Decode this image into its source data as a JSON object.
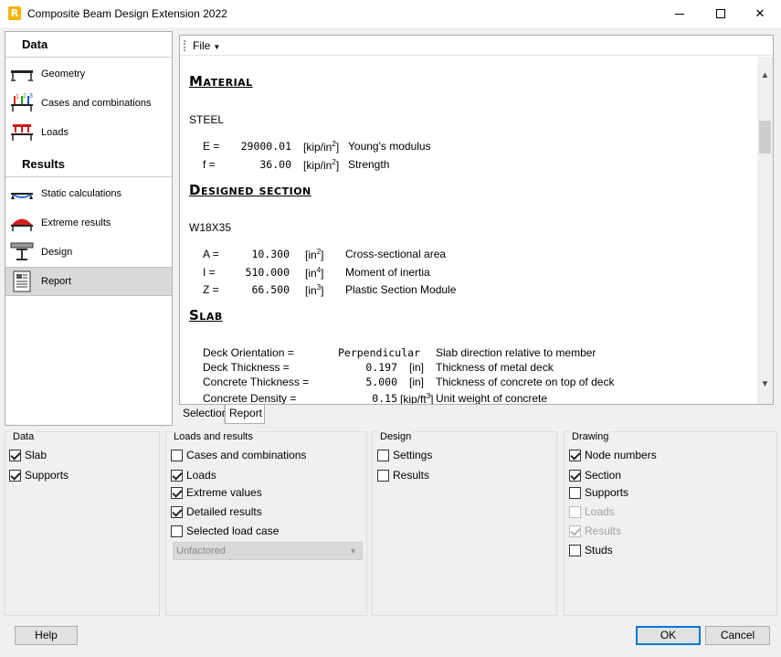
{
  "window": {
    "title": "Composite Beam Design Extension 2022",
    "app_icon_letter": "R",
    "minimize": "minimize-icon",
    "maximize": "maximize-icon",
    "close": "✕"
  },
  "nav": {
    "data_header": "Data",
    "results_header": "Results",
    "items": [
      {
        "label": "Geometry",
        "icon": "geometry-icon"
      },
      {
        "label": "Cases and combinations",
        "icon": "cases-icon"
      },
      {
        "label": "Loads",
        "icon": "loads-icon"
      },
      {
        "label": "Static calculations",
        "icon": "static-calc-icon"
      },
      {
        "label": "Extreme results",
        "icon": "extreme-results-icon"
      },
      {
        "label": "Design",
        "icon": "design-icon"
      },
      {
        "label": "Report",
        "icon": "report-icon"
      }
    ],
    "active": "Report"
  },
  "report": {
    "toolbar": {
      "file_label": "File"
    },
    "material": {
      "heading": "Material",
      "type": "STEEL",
      "rows": [
        {
          "sym": "E =",
          "val": "29000.01",
          "unit_base": "[kip/in",
          "unit_sup": "2",
          "unit_end": "]",
          "desc": "Young's modulus"
        },
        {
          "sym": "f =",
          "val": "36.00",
          "unit_base": "[kip/in",
          "unit_sup": "2",
          "unit_end": "]",
          "desc": "Strength"
        }
      ]
    },
    "section": {
      "heading": "Designed section",
      "name": "W18X35",
      "rows": [
        {
          "sym": "A =",
          "val": "10.300",
          "unit_base": "[in",
          "unit_sup": "2",
          "unit_end": "]",
          "desc": "Cross-sectional area"
        },
        {
          "sym": "I =",
          "val": "510.000",
          "unit_base": "[in",
          "unit_sup": "4",
          "unit_end": "]",
          "desc": "Moment of inertia"
        },
        {
          "sym": "Z =",
          "val": "66.500",
          "unit_base": "[in",
          "unit_sup": "3",
          "unit_end": "]",
          "desc": "Plastic Section Module"
        }
      ]
    },
    "slab": {
      "heading": "Slab",
      "rows": [
        {
          "sym": "Deck Orientation =",
          "val": "Perpendicular",
          "unit": "",
          "desc": "Slab direction relative to member"
        },
        {
          "sym": "Deck Thickness =",
          "val": "0.197",
          "unit": "[in]",
          "desc": "Thickness of metal deck"
        },
        {
          "sym": "Concrete Thickness =",
          "val": "5.000",
          "unit": "[in]",
          "desc": "Thickness of concrete on top of deck"
        },
        {
          "sym": "Concrete Density =",
          "val": "0.15",
          "unit_base": "[kip/ft",
          "unit_sup": "3",
          "unit_end": "]",
          "desc": "Unit weight of concrete"
        }
      ]
    }
  },
  "tabs": {
    "selection": "Selection",
    "report": "Report"
  },
  "groups": {
    "data": {
      "title": "Data",
      "items": [
        {
          "label": "Slab",
          "checked": true
        },
        {
          "label": "Supports",
          "checked": true
        }
      ]
    },
    "loads": {
      "title": "Loads and results",
      "items": [
        {
          "label": "Cases and combinations",
          "checked": false
        },
        {
          "label": "Loads",
          "checked": true
        },
        {
          "label": "Extreme values",
          "checked": true
        },
        {
          "label": "Detailed results",
          "checked": true
        },
        {
          "label": "Selected load case",
          "checked": false
        }
      ],
      "combo_value": "Unfactored"
    },
    "design": {
      "title": "Design",
      "items": [
        {
          "label": "Settings",
          "checked": false
        },
        {
          "label": "Results",
          "checked": false
        }
      ]
    },
    "drawing": {
      "title": "Drawing",
      "items": [
        {
          "label": "Node numbers",
          "checked": true,
          "disabled": false
        },
        {
          "label": "Section",
          "checked": true,
          "disabled": false
        },
        {
          "label": "Supports",
          "checked": false,
          "disabled": false
        },
        {
          "label": "Loads",
          "checked": false,
          "disabled": true
        },
        {
          "label": "Results",
          "checked": true,
          "disabled": true
        },
        {
          "label": "Studs",
          "checked": false,
          "disabled": false
        }
      ]
    }
  },
  "buttons": {
    "help": "Help",
    "ok": "OK",
    "cancel": "Cancel"
  }
}
